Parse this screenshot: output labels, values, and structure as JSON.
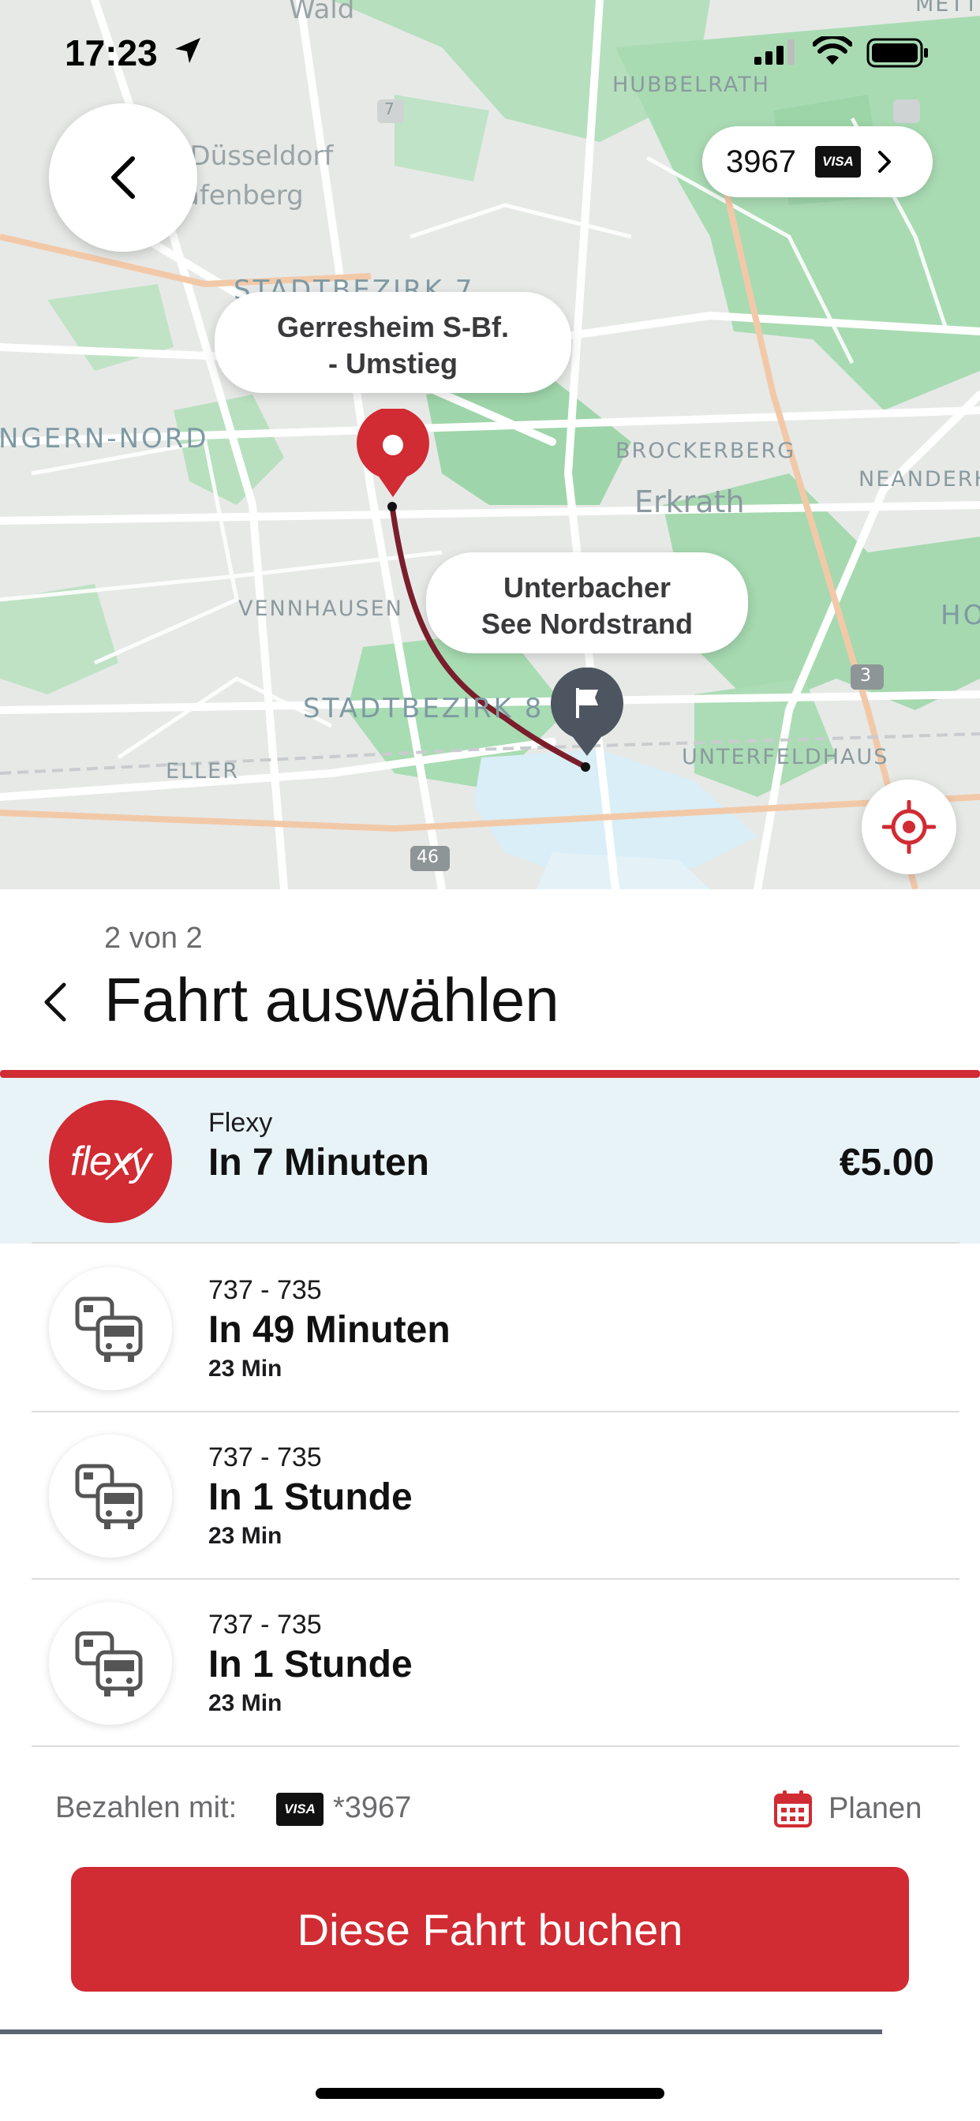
{
  "status_bar": {
    "time": "17:23"
  },
  "map": {
    "labels": {
      "wald": "Wald",
      "park": "rk Düsseldorf",
      "grafenberg": "rafenberg",
      "hubbelrath": "HUBBELRATH",
      "mettmann": "METT",
      "stadtbezirk7": "STADTBEZIRK 7",
      "gerresheim_nord": "NGERN-NORD",
      "brockerberg": "BROCKERBERG",
      "neanderhoehe": "NEANDERH",
      "erkrath": "Erkrath",
      "vennhausen": "VENNHAUSEN",
      "ho": "HO",
      "stadtbezirk8": "STADTBEZIRK 8",
      "eller": "ELLER",
      "unterfeldhaus": "UNTERFELDHAUS",
      "road_46": "46",
      "road_3": "3",
      "road_7": "7"
    },
    "origin_label": "Gerresheim S-Bf.\n- Umstieg",
    "origin_line1": "Gerresheim S-Bf.",
    "origin_line2": "- Umstieg",
    "destination_line1": "Unterbacher",
    "destination_line2": "See Nordstrand",
    "payment_pill": {
      "card_number": "3967",
      "card_brand": "VISA"
    }
  },
  "panel": {
    "step": "2 von 2",
    "title": "Fahrt auswählen",
    "rides": [
      {
        "line": "Flexy",
        "time": "In 7 Minuten",
        "duration": "",
        "price": "€5.00",
        "icon": "flexy-logo",
        "logo_text": "flexy",
        "selected": true
      },
      {
        "line": "737 - 735",
        "time": "In 49 Minuten",
        "duration": "23 Min",
        "price": "",
        "icon": "bus-transfer-icon",
        "selected": false
      },
      {
        "line": "737 - 735",
        "time": "In 1 Stunde",
        "duration": "23 Min",
        "price": "",
        "icon": "bus-transfer-icon",
        "selected": false
      },
      {
        "line": "737 - 735",
        "time": "In 1 Stunde",
        "duration": "23 Min",
        "price": "",
        "icon": "bus-transfer-icon",
        "selected": false
      }
    ],
    "payment": {
      "label": "Bezahlen mit:",
      "card_brand": "VISA",
      "card": "*3967"
    },
    "plan_label": "Planen",
    "book_button": "Diese Fahrt buchen"
  },
  "colors": {
    "accent_red": "#d12b33",
    "selected_row_bg": "#e8f3f8",
    "map_green": "#a8dcb2",
    "route": "#7a1e2c"
  }
}
